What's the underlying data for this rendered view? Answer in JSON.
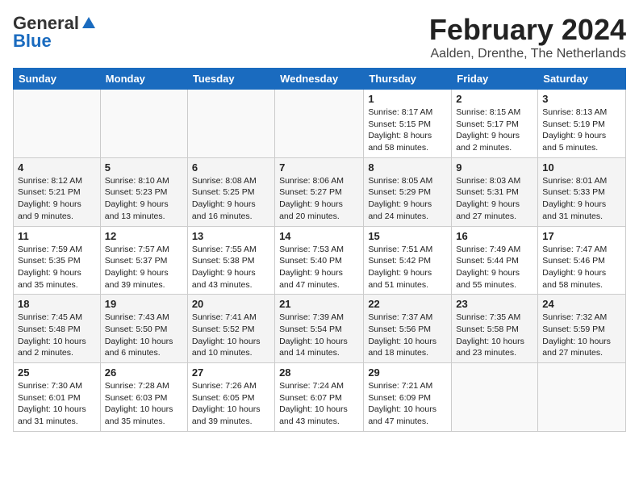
{
  "logo": {
    "general": "General",
    "blue": "Blue"
  },
  "title": {
    "month_year": "February 2024",
    "location": "Aalden, Drenthe, The Netherlands"
  },
  "days_of_week": [
    "Sunday",
    "Monday",
    "Tuesday",
    "Wednesday",
    "Thursday",
    "Friday",
    "Saturday"
  ],
  "weeks": [
    [
      {
        "day": "",
        "info": ""
      },
      {
        "day": "",
        "info": ""
      },
      {
        "day": "",
        "info": ""
      },
      {
        "day": "",
        "info": ""
      },
      {
        "day": "1",
        "info": "Sunrise: 8:17 AM\nSunset: 5:15 PM\nDaylight: 8 hours\nand 58 minutes."
      },
      {
        "day": "2",
        "info": "Sunrise: 8:15 AM\nSunset: 5:17 PM\nDaylight: 9 hours\nand 2 minutes."
      },
      {
        "day": "3",
        "info": "Sunrise: 8:13 AM\nSunset: 5:19 PM\nDaylight: 9 hours\nand 5 minutes."
      }
    ],
    [
      {
        "day": "4",
        "info": "Sunrise: 8:12 AM\nSunset: 5:21 PM\nDaylight: 9 hours\nand 9 minutes."
      },
      {
        "day": "5",
        "info": "Sunrise: 8:10 AM\nSunset: 5:23 PM\nDaylight: 9 hours\nand 13 minutes."
      },
      {
        "day": "6",
        "info": "Sunrise: 8:08 AM\nSunset: 5:25 PM\nDaylight: 9 hours\nand 16 minutes."
      },
      {
        "day": "7",
        "info": "Sunrise: 8:06 AM\nSunset: 5:27 PM\nDaylight: 9 hours\nand 20 minutes."
      },
      {
        "day": "8",
        "info": "Sunrise: 8:05 AM\nSunset: 5:29 PM\nDaylight: 9 hours\nand 24 minutes."
      },
      {
        "day": "9",
        "info": "Sunrise: 8:03 AM\nSunset: 5:31 PM\nDaylight: 9 hours\nand 27 minutes."
      },
      {
        "day": "10",
        "info": "Sunrise: 8:01 AM\nSunset: 5:33 PM\nDaylight: 9 hours\nand 31 minutes."
      }
    ],
    [
      {
        "day": "11",
        "info": "Sunrise: 7:59 AM\nSunset: 5:35 PM\nDaylight: 9 hours\nand 35 minutes."
      },
      {
        "day": "12",
        "info": "Sunrise: 7:57 AM\nSunset: 5:37 PM\nDaylight: 9 hours\nand 39 minutes."
      },
      {
        "day": "13",
        "info": "Sunrise: 7:55 AM\nSunset: 5:38 PM\nDaylight: 9 hours\nand 43 minutes."
      },
      {
        "day": "14",
        "info": "Sunrise: 7:53 AM\nSunset: 5:40 PM\nDaylight: 9 hours\nand 47 minutes."
      },
      {
        "day": "15",
        "info": "Sunrise: 7:51 AM\nSunset: 5:42 PM\nDaylight: 9 hours\nand 51 minutes."
      },
      {
        "day": "16",
        "info": "Sunrise: 7:49 AM\nSunset: 5:44 PM\nDaylight: 9 hours\nand 55 minutes."
      },
      {
        "day": "17",
        "info": "Sunrise: 7:47 AM\nSunset: 5:46 PM\nDaylight: 9 hours\nand 58 minutes."
      }
    ],
    [
      {
        "day": "18",
        "info": "Sunrise: 7:45 AM\nSunset: 5:48 PM\nDaylight: 10 hours\nand 2 minutes."
      },
      {
        "day": "19",
        "info": "Sunrise: 7:43 AM\nSunset: 5:50 PM\nDaylight: 10 hours\nand 6 minutes."
      },
      {
        "day": "20",
        "info": "Sunrise: 7:41 AM\nSunset: 5:52 PM\nDaylight: 10 hours\nand 10 minutes."
      },
      {
        "day": "21",
        "info": "Sunrise: 7:39 AM\nSunset: 5:54 PM\nDaylight: 10 hours\nand 14 minutes."
      },
      {
        "day": "22",
        "info": "Sunrise: 7:37 AM\nSunset: 5:56 PM\nDaylight: 10 hours\nand 18 minutes."
      },
      {
        "day": "23",
        "info": "Sunrise: 7:35 AM\nSunset: 5:58 PM\nDaylight: 10 hours\nand 23 minutes."
      },
      {
        "day": "24",
        "info": "Sunrise: 7:32 AM\nSunset: 5:59 PM\nDaylight: 10 hours\nand 27 minutes."
      }
    ],
    [
      {
        "day": "25",
        "info": "Sunrise: 7:30 AM\nSunset: 6:01 PM\nDaylight: 10 hours\nand 31 minutes."
      },
      {
        "day": "26",
        "info": "Sunrise: 7:28 AM\nSunset: 6:03 PM\nDaylight: 10 hours\nand 35 minutes."
      },
      {
        "day": "27",
        "info": "Sunrise: 7:26 AM\nSunset: 6:05 PM\nDaylight: 10 hours\nand 39 minutes."
      },
      {
        "day": "28",
        "info": "Sunrise: 7:24 AM\nSunset: 6:07 PM\nDaylight: 10 hours\nand 43 minutes."
      },
      {
        "day": "29",
        "info": "Sunrise: 7:21 AM\nSunset: 6:09 PM\nDaylight: 10 hours\nand 47 minutes."
      },
      {
        "day": "",
        "info": ""
      },
      {
        "day": "",
        "info": ""
      }
    ]
  ]
}
